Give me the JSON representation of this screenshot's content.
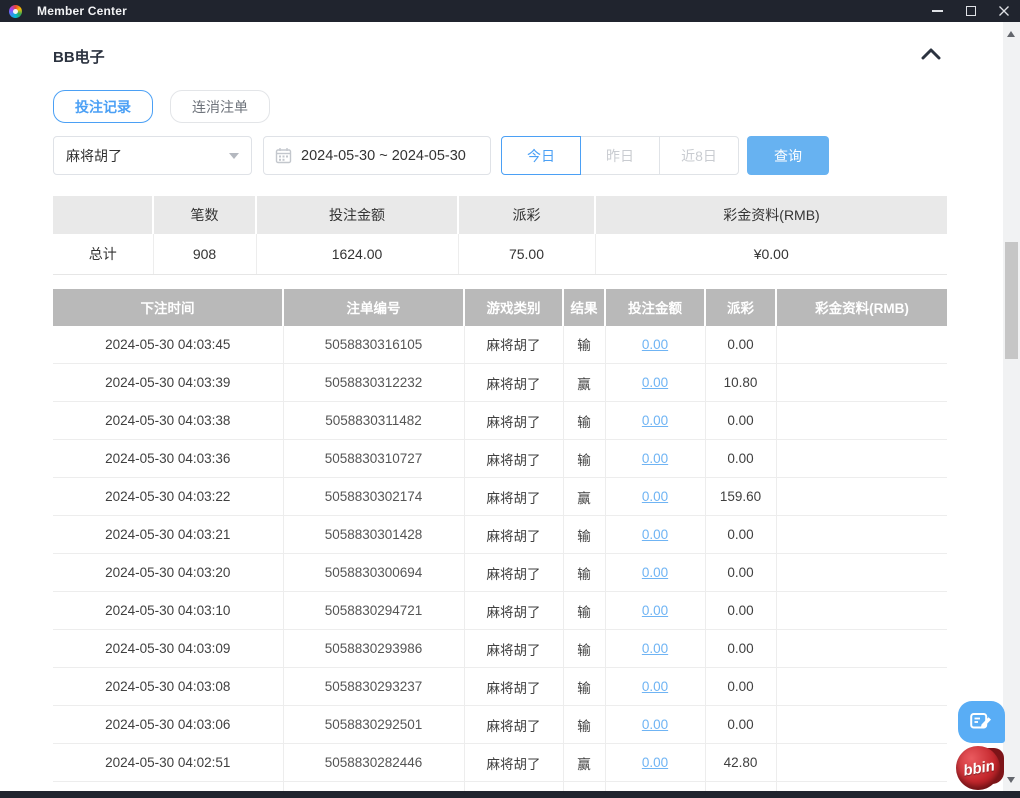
{
  "titlebar": {
    "title": "Member Center"
  },
  "section": {
    "title": "BB电子"
  },
  "tabs": [
    {
      "label": "投注记录",
      "active": true
    },
    {
      "label": "连消注单",
      "active": false
    }
  ],
  "filters": {
    "game_dropdown_value": "麻将胡了",
    "date_range": "2024-05-30 ~ 2024-05-30",
    "quick_ranges": [
      {
        "label": "今日",
        "active": true
      },
      {
        "label": "昨日",
        "active": false
      },
      {
        "label": "近8日",
        "active": false
      }
    ],
    "search_button": "查询"
  },
  "summary": {
    "headers": [
      "",
      "笔数",
      "投注金额",
      "派彩",
      "彩金资料(RMB)"
    ],
    "total_row": [
      "总计",
      "908",
      "1624.00",
      "75.00",
      "¥0.00"
    ]
  },
  "bet_table": {
    "headers": [
      "下注时间",
      "注单编号",
      "游戏类别",
      "结果",
      "投注金额",
      "派彩",
      "彩金资料(RMB)"
    ],
    "rows": [
      {
        "time": "2024-05-30 04:03:45",
        "id": "5058830316105",
        "game": "麻将胡了",
        "result": "输",
        "bet": "0.00",
        "payout": "0.00",
        "bonus": ""
      },
      {
        "time": "2024-05-30 04:03:39",
        "id": "5058830312232",
        "game": "麻将胡了",
        "result": "赢",
        "bet": "0.00",
        "payout": "10.80",
        "bonus": ""
      },
      {
        "time": "2024-05-30 04:03:38",
        "id": "5058830311482",
        "game": "麻将胡了",
        "result": "输",
        "bet": "0.00",
        "payout": "0.00",
        "bonus": ""
      },
      {
        "time": "2024-05-30 04:03:36",
        "id": "5058830310727",
        "game": "麻将胡了",
        "result": "输",
        "bet": "0.00",
        "payout": "0.00",
        "bonus": ""
      },
      {
        "time": "2024-05-30 04:03:22",
        "id": "5058830302174",
        "game": "麻将胡了",
        "result": "赢",
        "bet": "0.00",
        "payout": "159.60",
        "bonus": ""
      },
      {
        "time": "2024-05-30 04:03:21",
        "id": "5058830301428",
        "game": "麻将胡了",
        "result": "输",
        "bet": "0.00",
        "payout": "0.00",
        "bonus": ""
      },
      {
        "time": "2024-05-30 04:03:20",
        "id": "5058830300694",
        "game": "麻将胡了",
        "result": "输",
        "bet": "0.00",
        "payout": "0.00",
        "bonus": ""
      },
      {
        "time": "2024-05-30 04:03:10",
        "id": "5058830294721",
        "game": "麻将胡了",
        "result": "输",
        "bet": "0.00",
        "payout": "0.00",
        "bonus": ""
      },
      {
        "time": "2024-05-30 04:03:09",
        "id": "5058830293986",
        "game": "麻将胡了",
        "result": "输",
        "bet": "0.00",
        "payout": "0.00",
        "bonus": ""
      },
      {
        "time": "2024-05-30 04:03:08",
        "id": "5058830293237",
        "game": "麻将胡了",
        "result": "输",
        "bet": "0.00",
        "payout": "0.00",
        "bonus": ""
      },
      {
        "time": "2024-05-30 04:03:06",
        "id": "5058830292501",
        "game": "麻将胡了",
        "result": "输",
        "bet": "0.00",
        "payout": "0.00",
        "bonus": ""
      },
      {
        "time": "2024-05-30 04:02:51",
        "id": "5058830282446",
        "game": "麻将胡了",
        "result": "赢",
        "bet": "0.00",
        "payout": "42.80",
        "bonus": ""
      }
    ]
  },
  "floating": {
    "bbin_text": "bbin"
  },
  "colors": {
    "accent_blue": "#4ba0f5",
    "search_button_bg": "#67b2f1",
    "link_blue": "#6fb4f4",
    "table_header_bg": "#b9b9b9",
    "summary_header_bg": "#e9e9e9",
    "titlebar_bg": "#20242e",
    "bbin_red": "#c4272d"
  }
}
